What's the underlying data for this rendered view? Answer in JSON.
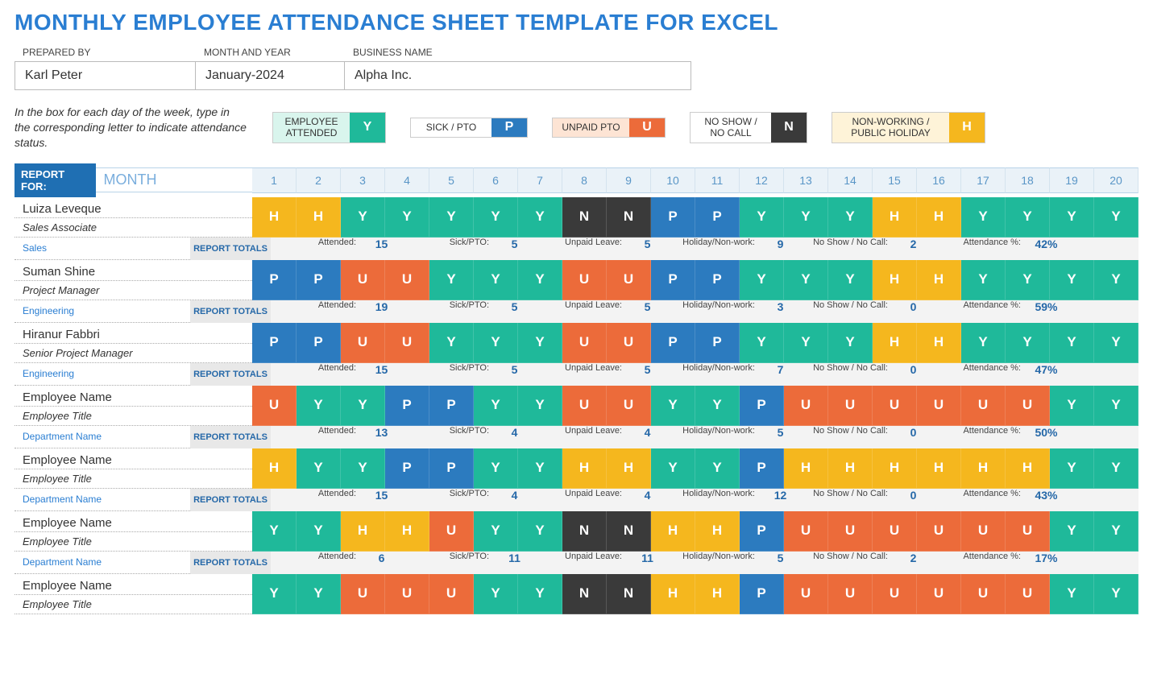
{
  "title": "MONTHLY EMPLOYEE ATTENDANCE SHEET TEMPLATE FOR EXCEL",
  "header": {
    "preparedByLabel": "PREPARED BY",
    "preparedBy": "Karl Peter",
    "monthYearLabel": "MONTH AND YEAR",
    "monthYear": "January-2024",
    "businessLabel": "BUSINESS NAME",
    "business": "Alpha Inc."
  },
  "instructions": "In the box for each day of the week, type in the corresponding letter to indicate attendance status.",
  "legend": {
    "attended": "EMPLOYEE ATTENDED",
    "attendedCode": "Y",
    "sick": "SICK / PTO",
    "sickCode": "P",
    "unpaid": "UNPAID PTO",
    "unpaidCode": "U",
    "noshow": "NO SHOW / NO CALL",
    "noshowCode": "N",
    "holiday": "NON-WORKING / PUBLIC HOLIDAY",
    "holidayCode": "H"
  },
  "reportForLabel": "REPORT FOR:",
  "monthLabel": "MONTH",
  "reportTotalsLabel": "REPORT TOTALS",
  "days": [
    "1",
    "2",
    "3",
    "4",
    "5",
    "6",
    "7",
    "8",
    "9",
    "10",
    "11",
    "12",
    "13",
    "14",
    "15",
    "16",
    "17",
    "18",
    "19",
    "20"
  ],
  "totalsLabels": {
    "attended": "Attended:",
    "sick": "Sick/PTO:",
    "unpaid": "Unpaid Leave:",
    "holiday": "Holiday/Non-work:",
    "noshow": "No Show / No Call:",
    "pct": "Attendance %:"
  },
  "employees": [
    {
      "name": "Luiza Leveque",
      "title": "Sales Associate",
      "dept": "Sales",
      "days": [
        "H",
        "H",
        "Y",
        "Y",
        "Y",
        "Y",
        "Y",
        "N",
        "N",
        "P",
        "P",
        "Y",
        "Y",
        "Y",
        "H",
        "H",
        "Y",
        "Y",
        "Y",
        "Y"
      ],
      "totals": {
        "attended": "15",
        "sick": "5",
        "unpaid": "5",
        "holiday": "9",
        "noshow": "2",
        "pct": "42%"
      }
    },
    {
      "name": "Suman Shine",
      "title": "Project Manager",
      "dept": "Engineering",
      "days": [
        "P",
        "P",
        "U",
        "U",
        "Y",
        "Y",
        "Y",
        "U",
        "U",
        "P",
        "P",
        "Y",
        "Y",
        "Y",
        "H",
        "H",
        "Y",
        "Y",
        "Y",
        "Y"
      ],
      "totals": {
        "attended": "19",
        "sick": "5",
        "unpaid": "5",
        "holiday": "3",
        "noshow": "0",
        "pct": "59%"
      }
    },
    {
      "name": "Hiranur Fabbri",
      "title": "Senior Project Manager",
      "dept": "Engineering",
      "days": [
        "P",
        "P",
        "U",
        "U",
        "Y",
        "Y",
        "Y",
        "U",
        "U",
        "P",
        "P",
        "Y",
        "Y",
        "Y",
        "H",
        "H",
        "Y",
        "Y",
        "Y",
        "Y"
      ],
      "totals": {
        "attended": "15",
        "sick": "5",
        "unpaid": "5",
        "holiday": "7",
        "noshow": "0",
        "pct": "47%"
      }
    },
    {
      "name": "Employee Name",
      "title": "Employee Title",
      "dept": "Department Name",
      "days": [
        "U",
        "Y",
        "Y",
        "P",
        "P",
        "Y",
        "Y",
        "U",
        "U",
        "Y",
        "Y",
        "P",
        "U",
        "U",
        "U",
        "U",
        "U",
        "U",
        "Y",
        "Y"
      ],
      "totals": {
        "attended": "13",
        "sick": "4",
        "unpaid": "4",
        "holiday": "5",
        "noshow": "0",
        "pct": "50%"
      }
    },
    {
      "name": "Employee Name",
      "title": "Employee Title",
      "dept": "Department Name",
      "days": [
        "H",
        "Y",
        "Y",
        "P",
        "P",
        "Y",
        "Y",
        "H",
        "H",
        "Y",
        "Y",
        "P",
        "H",
        "H",
        "H",
        "H",
        "H",
        "H",
        "Y",
        "Y"
      ],
      "totals": {
        "attended": "15",
        "sick": "4",
        "unpaid": "4",
        "holiday": "12",
        "noshow": "0",
        "pct": "43%"
      }
    },
    {
      "name": "Employee Name",
      "title": "Employee Title",
      "dept": "Department Name",
      "days": [
        "Y",
        "Y",
        "H",
        "H",
        "U",
        "Y",
        "Y",
        "N",
        "N",
        "H",
        "H",
        "P",
        "U",
        "U",
        "U",
        "U",
        "U",
        "U",
        "Y",
        "Y"
      ],
      "totals": {
        "attended": "6",
        "sick": "11",
        "unpaid": "11",
        "holiday": "5",
        "noshow": "2",
        "pct": "17%"
      }
    },
    {
      "name": "Employee Name",
      "title": "Employee Title",
      "dept": "",
      "days": [
        "Y",
        "Y",
        "U",
        "U",
        "U",
        "Y",
        "Y",
        "N",
        "N",
        "H",
        "H",
        "P",
        "U",
        "U",
        "U",
        "U",
        "U",
        "U",
        "Y",
        "Y"
      ],
      "totals": null
    }
  ]
}
